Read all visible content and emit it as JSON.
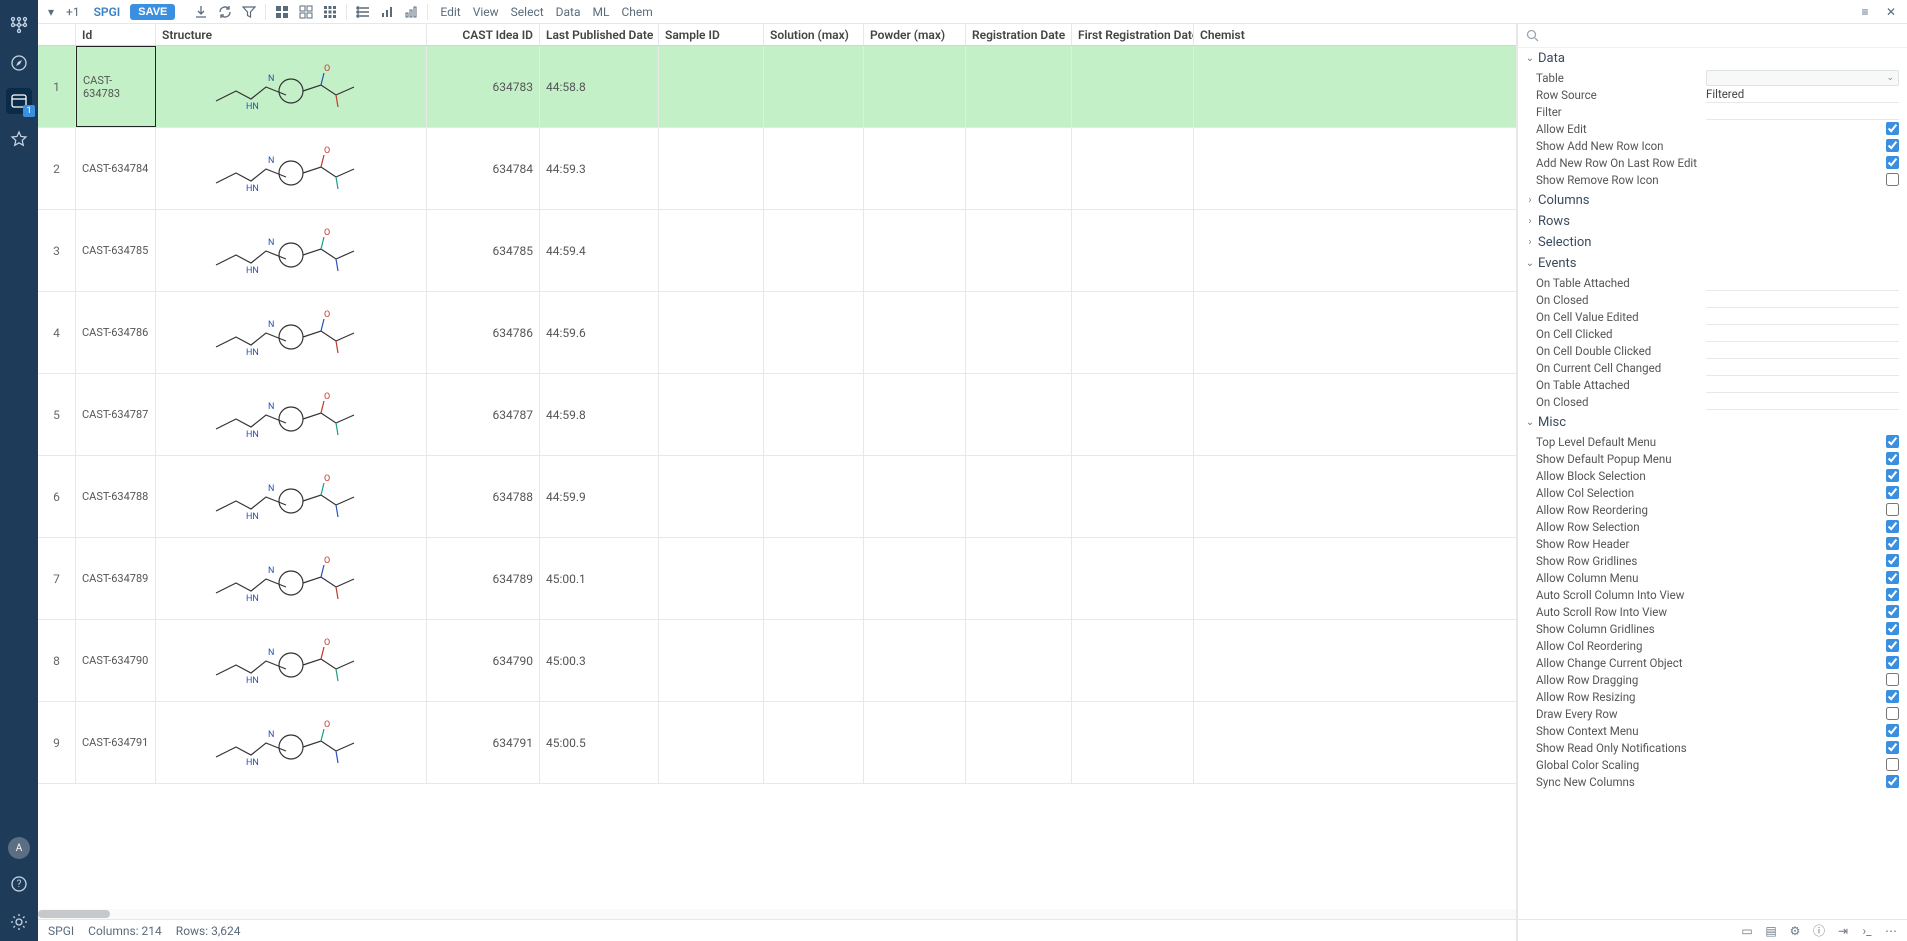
{
  "toolbar": {
    "workspace_dropdown": "▾",
    "plus_label": "+1",
    "title": "SPGI",
    "save_label": "SAVE",
    "menus": [
      "Edit",
      "View",
      "Select",
      "Data",
      "ML",
      "Chem"
    ]
  },
  "leftrail": {
    "avatar": "A"
  },
  "columns": [
    "",
    "Id",
    "Structure",
    "CAST Idea ID",
    "Last Published Date",
    "Sample ID",
    "Solution (max)",
    "Powder (max)",
    "Registration Date",
    "First Registration Date",
    "Chemist"
  ],
  "rows": [
    {
      "n": "1",
      "id": "CAST-634783",
      "castid": "634783",
      "lpd": "44:58.8",
      "sel": true
    },
    {
      "n": "2",
      "id": "CAST-634784",
      "castid": "634784",
      "lpd": "44:59.3"
    },
    {
      "n": "3",
      "id": "CAST-634785",
      "castid": "634785",
      "lpd": "44:59.4"
    },
    {
      "n": "4",
      "id": "CAST-634786",
      "castid": "634786",
      "lpd": "44:59.6"
    },
    {
      "n": "5",
      "id": "CAST-634787",
      "castid": "634787",
      "lpd": "44:59.8"
    },
    {
      "n": "6",
      "id": "CAST-634788",
      "castid": "634788",
      "lpd": "44:59.9"
    },
    {
      "n": "7",
      "id": "CAST-634789",
      "castid": "634789",
      "lpd": "45:00.1"
    },
    {
      "n": "8",
      "id": "CAST-634790",
      "castid": "634790",
      "lpd": "45:00.3"
    },
    {
      "n": "9",
      "id": "CAST-634791",
      "castid": "634791",
      "lpd": "45:00.5"
    }
  ],
  "status": {
    "ds": "SPGI",
    "cols": "Columns: 214",
    "rows": "Rows: 3,624"
  },
  "panel": {
    "sections": {
      "data": {
        "title": "Data",
        "open": true,
        "props": [
          {
            "k": "Table",
            "type": "select",
            "v": ""
          },
          {
            "k": "Row Source",
            "type": "text",
            "v": "Filtered"
          },
          {
            "k": "Filter",
            "type": "text",
            "v": ""
          },
          {
            "k": "Allow Edit",
            "type": "check",
            "v": true
          },
          {
            "k": "Show Add New Row Icon",
            "type": "check",
            "v": true
          },
          {
            "k": "Add New Row On Last Row Edit",
            "type": "check",
            "v": true
          },
          {
            "k": "Show Remove Row Icon",
            "type": "check",
            "v": false
          }
        ]
      },
      "columns": {
        "title": "Columns",
        "open": false
      },
      "rowsS": {
        "title": "Rows",
        "open": false
      },
      "selection": {
        "title": "Selection",
        "open": false
      },
      "events": {
        "title": "Events",
        "open": true,
        "props": [
          {
            "k": "On Table Attached",
            "type": "text",
            "v": ""
          },
          {
            "k": "On Closed",
            "type": "text",
            "v": ""
          },
          {
            "k": "On Cell Value Edited",
            "type": "text",
            "v": ""
          },
          {
            "k": "On Cell Clicked",
            "type": "text",
            "v": ""
          },
          {
            "k": "On Cell Double Clicked",
            "type": "text",
            "v": ""
          },
          {
            "k": "On Current Cell Changed",
            "type": "text",
            "v": ""
          },
          {
            "k": "On Table Attached",
            "type": "text",
            "v": ""
          },
          {
            "k": "On Closed",
            "type": "text",
            "v": ""
          }
        ]
      },
      "misc": {
        "title": "Misc",
        "open": true,
        "props": [
          {
            "k": "Top Level Default Menu",
            "type": "check",
            "v": true
          },
          {
            "k": "Show Default Popup Menu",
            "type": "check",
            "v": true
          },
          {
            "k": "Allow Block Selection",
            "type": "check",
            "v": true
          },
          {
            "k": "Allow Col Selection",
            "type": "check",
            "v": true
          },
          {
            "k": "Allow Row Reordering",
            "type": "check",
            "v": false
          },
          {
            "k": "Allow Row Selection",
            "type": "check",
            "v": true
          },
          {
            "k": "Show Row Header",
            "type": "check",
            "v": true
          },
          {
            "k": "Show Row Gridlines",
            "type": "check",
            "v": true
          },
          {
            "k": "Allow Column Menu",
            "type": "check",
            "v": true
          },
          {
            "k": "Auto Scroll Column Into View",
            "type": "check",
            "v": true
          },
          {
            "k": "Auto Scroll Row Into View",
            "type": "check",
            "v": true
          },
          {
            "k": "Show Column Gridlines",
            "type": "check",
            "v": true
          },
          {
            "k": "Allow Col Reordering",
            "type": "check",
            "v": true
          },
          {
            "k": "Allow Change Current Object",
            "type": "check",
            "v": true
          },
          {
            "k": "Allow Row Dragging",
            "type": "check",
            "v": false
          },
          {
            "k": "Allow Row Resizing",
            "type": "check",
            "v": true
          },
          {
            "k": "Draw Every Row",
            "type": "check",
            "v": false
          },
          {
            "k": "Show Context Menu",
            "type": "check",
            "v": true
          },
          {
            "k": "Show Read Only Notifications",
            "type": "check",
            "v": true
          },
          {
            "k": "Global Color Scaling",
            "type": "check",
            "v": false
          },
          {
            "k": "Sync New Columns",
            "type": "check",
            "v": true
          }
        ]
      }
    }
  }
}
